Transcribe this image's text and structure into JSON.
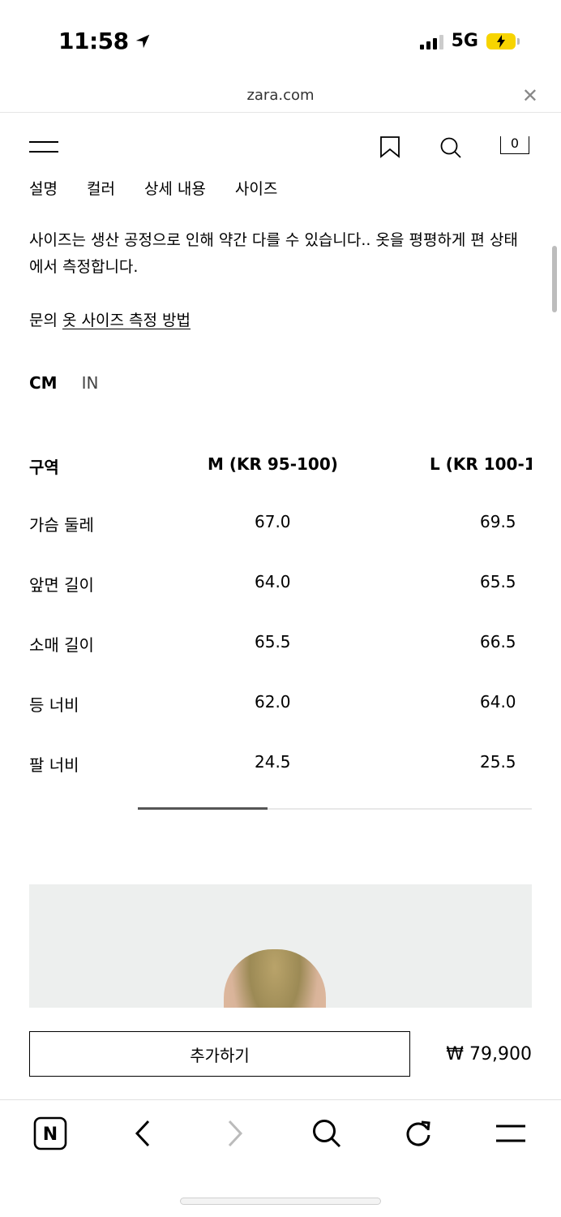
{
  "status_bar": {
    "time": "11:58",
    "network": "5G"
  },
  "browser": {
    "url": "zara.com"
  },
  "header": {
    "cart_count": "0"
  },
  "tabs": [
    "설명",
    "컬러",
    "상세 내용",
    "사이즈"
  ],
  "size_info": {
    "description": "사이즈는 생산 공정으로 인해 약간 다를 수 있습니다.. 옷을 평평하게 편 상태에서 측정합니다.",
    "help_prefix": "문의",
    "help_link": "옷 사이즈 측정 방법",
    "units": [
      "CM",
      "IN"
    ],
    "active_unit": "CM"
  },
  "size_table": {
    "headers": [
      "구역",
      "M (KR 95-100)",
      "L (KR 100-1"
    ],
    "rows": [
      {
        "label": "가슴 둘레",
        "m": "67.0",
        "l": "69.5"
      },
      {
        "label": "앞면 길이",
        "m": "64.0",
        "l": "65.5"
      },
      {
        "label": "소매 길이",
        "m": "65.5",
        "l": "66.5"
      },
      {
        "label": "등 너비",
        "m": "62.0",
        "l": "64.0"
      },
      {
        "label": "팔 너비",
        "m": "24.5",
        "l": "25.5"
      }
    ]
  },
  "purchase": {
    "add_label": "추가하기",
    "price": "₩ 79,900"
  },
  "toolbar": {
    "home_letter": "N"
  },
  "colors": {
    "accent": "#000000",
    "battery": "#f7d400"
  }
}
